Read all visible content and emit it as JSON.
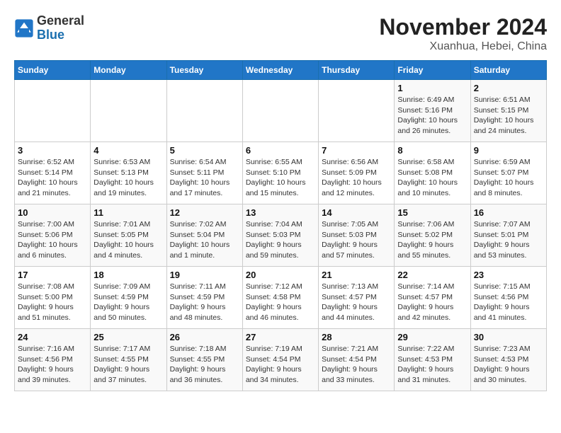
{
  "header": {
    "logo_general": "General",
    "logo_blue": "Blue",
    "month_title": "November 2024",
    "location": "Xuanhua, Hebei, China"
  },
  "days_of_week": [
    "Sunday",
    "Monday",
    "Tuesday",
    "Wednesday",
    "Thursday",
    "Friday",
    "Saturday"
  ],
  "weeks": [
    [
      {
        "day": "",
        "info": ""
      },
      {
        "day": "",
        "info": ""
      },
      {
        "day": "",
        "info": ""
      },
      {
        "day": "",
        "info": ""
      },
      {
        "day": "",
        "info": ""
      },
      {
        "day": "1",
        "info": "Sunrise: 6:49 AM\nSunset: 5:16 PM\nDaylight: 10 hours\nand 26 minutes."
      },
      {
        "day": "2",
        "info": "Sunrise: 6:51 AM\nSunset: 5:15 PM\nDaylight: 10 hours\nand 24 minutes."
      }
    ],
    [
      {
        "day": "3",
        "info": "Sunrise: 6:52 AM\nSunset: 5:14 PM\nDaylight: 10 hours\nand 21 minutes."
      },
      {
        "day": "4",
        "info": "Sunrise: 6:53 AM\nSunset: 5:13 PM\nDaylight: 10 hours\nand 19 minutes."
      },
      {
        "day": "5",
        "info": "Sunrise: 6:54 AM\nSunset: 5:11 PM\nDaylight: 10 hours\nand 17 minutes."
      },
      {
        "day": "6",
        "info": "Sunrise: 6:55 AM\nSunset: 5:10 PM\nDaylight: 10 hours\nand 15 minutes."
      },
      {
        "day": "7",
        "info": "Sunrise: 6:56 AM\nSunset: 5:09 PM\nDaylight: 10 hours\nand 12 minutes."
      },
      {
        "day": "8",
        "info": "Sunrise: 6:58 AM\nSunset: 5:08 PM\nDaylight: 10 hours\nand 10 minutes."
      },
      {
        "day": "9",
        "info": "Sunrise: 6:59 AM\nSunset: 5:07 PM\nDaylight: 10 hours\nand 8 minutes."
      }
    ],
    [
      {
        "day": "10",
        "info": "Sunrise: 7:00 AM\nSunset: 5:06 PM\nDaylight: 10 hours\nand 6 minutes."
      },
      {
        "day": "11",
        "info": "Sunrise: 7:01 AM\nSunset: 5:05 PM\nDaylight: 10 hours\nand 4 minutes."
      },
      {
        "day": "12",
        "info": "Sunrise: 7:02 AM\nSunset: 5:04 PM\nDaylight: 10 hours\nand 1 minute."
      },
      {
        "day": "13",
        "info": "Sunrise: 7:04 AM\nSunset: 5:03 PM\nDaylight: 9 hours\nand 59 minutes."
      },
      {
        "day": "14",
        "info": "Sunrise: 7:05 AM\nSunset: 5:03 PM\nDaylight: 9 hours\nand 57 minutes."
      },
      {
        "day": "15",
        "info": "Sunrise: 7:06 AM\nSunset: 5:02 PM\nDaylight: 9 hours\nand 55 minutes."
      },
      {
        "day": "16",
        "info": "Sunrise: 7:07 AM\nSunset: 5:01 PM\nDaylight: 9 hours\nand 53 minutes."
      }
    ],
    [
      {
        "day": "17",
        "info": "Sunrise: 7:08 AM\nSunset: 5:00 PM\nDaylight: 9 hours\nand 51 minutes."
      },
      {
        "day": "18",
        "info": "Sunrise: 7:09 AM\nSunset: 4:59 PM\nDaylight: 9 hours\nand 50 minutes."
      },
      {
        "day": "19",
        "info": "Sunrise: 7:11 AM\nSunset: 4:59 PM\nDaylight: 9 hours\nand 48 minutes."
      },
      {
        "day": "20",
        "info": "Sunrise: 7:12 AM\nSunset: 4:58 PM\nDaylight: 9 hours\nand 46 minutes."
      },
      {
        "day": "21",
        "info": "Sunrise: 7:13 AM\nSunset: 4:57 PM\nDaylight: 9 hours\nand 44 minutes."
      },
      {
        "day": "22",
        "info": "Sunrise: 7:14 AM\nSunset: 4:57 PM\nDaylight: 9 hours\nand 42 minutes."
      },
      {
        "day": "23",
        "info": "Sunrise: 7:15 AM\nSunset: 4:56 PM\nDaylight: 9 hours\nand 41 minutes."
      }
    ],
    [
      {
        "day": "24",
        "info": "Sunrise: 7:16 AM\nSunset: 4:56 PM\nDaylight: 9 hours\nand 39 minutes."
      },
      {
        "day": "25",
        "info": "Sunrise: 7:17 AM\nSunset: 4:55 PM\nDaylight: 9 hours\nand 37 minutes."
      },
      {
        "day": "26",
        "info": "Sunrise: 7:18 AM\nSunset: 4:55 PM\nDaylight: 9 hours\nand 36 minutes."
      },
      {
        "day": "27",
        "info": "Sunrise: 7:19 AM\nSunset: 4:54 PM\nDaylight: 9 hours\nand 34 minutes."
      },
      {
        "day": "28",
        "info": "Sunrise: 7:21 AM\nSunset: 4:54 PM\nDaylight: 9 hours\nand 33 minutes."
      },
      {
        "day": "29",
        "info": "Sunrise: 7:22 AM\nSunset: 4:53 PM\nDaylight: 9 hours\nand 31 minutes."
      },
      {
        "day": "30",
        "info": "Sunrise: 7:23 AM\nSunset: 4:53 PM\nDaylight: 9 hours\nand 30 minutes."
      }
    ]
  ]
}
